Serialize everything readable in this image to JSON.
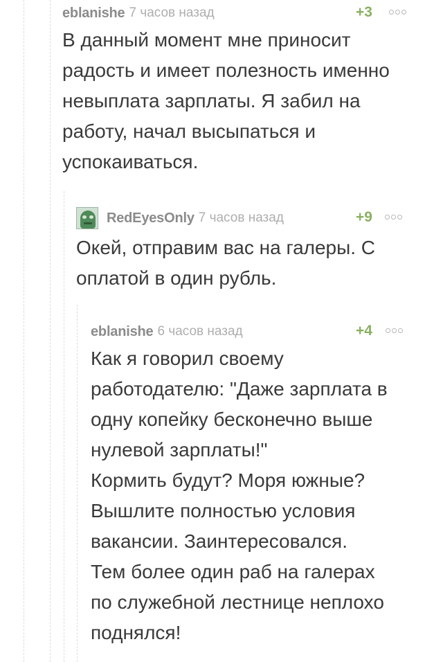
{
  "comments": [
    {
      "username": "eblanishe",
      "time": "7 часов назад",
      "rating": "+3",
      "text": "В данный момент мне приносит\nрадость и имеет полезность именно\nневыплата зарплаты. Я забил на\nработу, начал высыпаться и\nуспокаиваться."
    },
    {
      "username": "RedEyesOnly",
      "time": "7 часов назад",
      "rating": "+9",
      "text": "Окей, отправим вас на галеры. С\nоплатой в один рубль."
    },
    {
      "username": "eblanishe",
      "time": "6 часов назад",
      "rating": "+4",
      "text": "Как я говорил своему\nработодателю: \"Даже зарплата в\nодну копейку бесконечно выше\nнулевой зарплаты!\"\nКормить будут? Моря южные?\nВышлите полностью условия\nвакансии. Заинтересовался.\nТем более один раб на галерах\nпо служебной лестнице неплохо\nподнялся!"
    }
  ],
  "icons": {
    "more": "more-dots-icon",
    "avatar": "frog-avatar"
  }
}
